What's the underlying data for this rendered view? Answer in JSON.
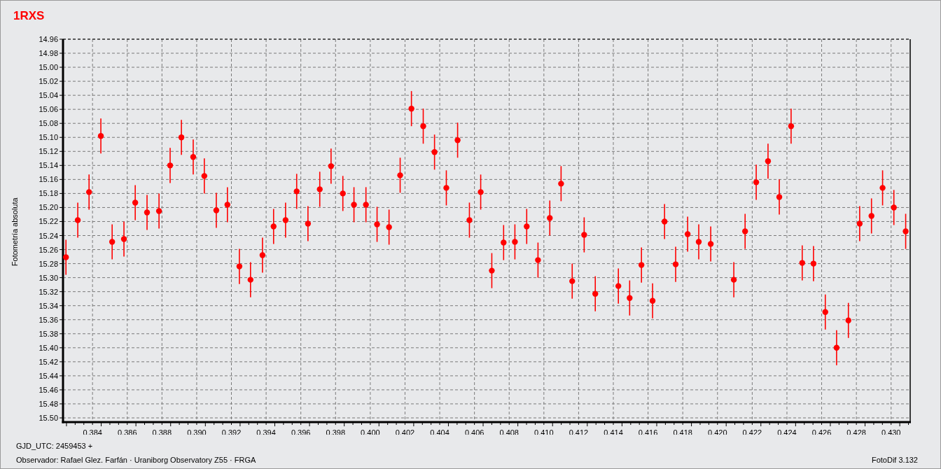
{
  "chart_data": {
    "type": "scatter",
    "title": "1RXS",
    "ylabel": "Fotometría absoluta",
    "xlim": [
      0.3823,
      0.4311
    ],
    "ylim": [
      15.506,
      14.96
    ],
    "xticks": [
      {
        "value": 0.384,
        "label": "0.384"
      },
      {
        "value": 0.386,
        "label": "0.386"
      },
      {
        "value": 0.388,
        "label": "0.388"
      },
      {
        "value": 0.39,
        "label": "0.390"
      },
      {
        "value": 0.392,
        "label": "0.392"
      },
      {
        "value": 0.394,
        "label": "0.394"
      },
      {
        "value": 0.396,
        "label": "0.396"
      },
      {
        "value": 0.398,
        "label": "0.398"
      },
      {
        "value": 0.4,
        "label": "0.400"
      },
      {
        "value": 0.402,
        "label": "0.402"
      },
      {
        "value": 0.404,
        "label": "0.404"
      },
      {
        "value": 0.406,
        "label": "0.406"
      },
      {
        "value": 0.408,
        "label": "0.408"
      },
      {
        "value": 0.41,
        "label": "0.410"
      },
      {
        "value": 0.412,
        "label": "0.412"
      },
      {
        "value": 0.414,
        "label": "0.414"
      },
      {
        "value": 0.416,
        "label": "0.416"
      },
      {
        "value": 0.418,
        "label": "0.418"
      },
      {
        "value": 0.42,
        "label": "0.420"
      },
      {
        "value": 0.422,
        "label": "0.422"
      },
      {
        "value": 0.424,
        "label": "0.424"
      },
      {
        "value": 0.426,
        "label": "0.426"
      },
      {
        "value": 0.428,
        "label": "0.428"
      },
      {
        "value": 0.43,
        "label": "0.430"
      }
    ],
    "yticks": [
      {
        "value": 14.96,
        "label": "14.96"
      },
      {
        "value": 14.98,
        "label": "14.98"
      },
      {
        "value": 15.0,
        "label": "15.00"
      },
      {
        "value": 15.02,
        "label": "15.02"
      },
      {
        "value": 15.04,
        "label": "15.04"
      },
      {
        "value": 15.06,
        "label": "15.06"
      },
      {
        "value": 15.08,
        "label": "15.08"
      },
      {
        "value": 15.1,
        "label": "15.10"
      },
      {
        "value": 15.12,
        "label": "15.12"
      },
      {
        "value": 15.14,
        "label": "15.14"
      },
      {
        "value": 15.16,
        "label": "15.16"
      },
      {
        "value": 15.18,
        "label": "15.18"
      },
      {
        "value": 15.2,
        "label": "15.20"
      },
      {
        "value": 15.22,
        "label": "15.22"
      },
      {
        "value": 15.24,
        "label": "15.24"
      },
      {
        "value": 15.26,
        "label": "15.26"
      },
      {
        "value": 15.28,
        "label": "15.28"
      },
      {
        "value": 15.3,
        "label": "15.30"
      },
      {
        "value": 15.32,
        "label": "15.32"
      },
      {
        "value": 15.34,
        "label": "15.34"
      },
      {
        "value": 15.36,
        "label": "15.36"
      },
      {
        "value": 15.38,
        "label": "15.38"
      },
      {
        "value": 15.4,
        "label": "15.40"
      },
      {
        "value": 15.42,
        "label": "15.42"
      },
      {
        "value": 15.44,
        "label": "15.44"
      },
      {
        "value": 15.46,
        "label": "15.46"
      },
      {
        "value": 15.48,
        "label": "15.48"
      },
      {
        "value": 15.5,
        "label": "15.50"
      }
    ],
    "x": [
      0.38247,
      0.38315,
      0.3838,
      0.38448,
      0.38513,
      0.38581,
      0.38646,
      0.38714,
      0.38783,
      0.38847,
      0.38912,
      0.3898,
      0.39044,
      0.39113,
      0.39177,
      0.39246,
      0.3931,
      0.39379,
      0.39443,
      0.39512,
      0.39576,
      0.39641,
      0.39709,
      0.39774,
      0.39842,
      0.39906,
      0.39975,
      0.40039,
      0.40108,
      0.40172,
      0.40237,
      0.40305,
      0.4037,
      0.40438,
      0.40503,
      0.40571,
      0.40636,
      0.407,
      0.40768,
      0.40833,
      0.40901,
      0.40966,
      0.41034,
      0.41099,
      0.41163,
      0.41232,
      0.41296,
      0.41429,
      0.41494,
      0.41562,
      0.41626,
      0.41695,
      0.41759,
      0.41828,
      0.41892,
      0.41961,
      0.42094,
      0.42159,
      0.42223,
      0.42291,
      0.42356,
      0.42424,
      0.42488,
      0.42553,
      0.42621,
      0.42686,
      0.42754,
      0.42819,
      0.42887,
      0.42951,
      0.43016,
      0.43084
    ],
    "grid": true,
    "series": [
      {
        "color": "#ff0000",
        "errors": [
          0.025,
          0.025,
          0.025,
          0.025,
          0.025,
          0.025,
          0.025,
          0.025,
          0.025,
          0.025,
          0.025,
          0.025,
          0.025,
          0.025,
          0.025,
          0.025,
          0.025,
          0.025,
          0.025,
          0.025,
          0.025,
          0.025,
          0.025,
          0.025,
          0.025,
          0.025,
          0.025,
          0.025,
          0.025,
          0.025,
          0.025,
          0.025,
          0.025,
          0.025,
          0.025,
          0.025,
          0.025,
          0.025,
          0.025,
          0.025,
          0.025,
          0.025,
          0.025,
          0.025,
          0.025,
          0.025,
          0.025,
          0.025,
          0.025,
          0.025,
          0.025,
          0.025,
          0.025,
          0.025,
          0.025,
          0.025,
          0.025,
          0.025,
          0.025,
          0.025,
          0.025,
          0.025,
          0.025,
          0.025,
          0.025,
          0.025,
          0.025,
          0.025,
          0.025,
          0.025,
          0.025,
          0.025
        ],
        "values": [
          15.271,
          15.218,
          15.178,
          15.098,
          15.249,
          15.245,
          15.193,
          15.207,
          15.205,
          15.14,
          15.1,
          15.128,
          15.155,
          15.204,
          15.196,
          15.284,
          15.303,
          15.268,
          15.227,
          15.218,
          15.177,
          15.223,
          15.174,
          15.141,
          15.18,
          15.196,
          15.196,
          15.224,
          15.228,
          15.154,
          15.059,
          15.084,
          15.121,
          15.172,
          15.104,
          15.218,
          15.178,
          15.29,
          15.25,
          15.249,
          15.227,
          15.275,
          15.215,
          15.166,
          15.305,
          15.239,
          15.323,
          15.312,
          15.329,
          15.282,
          15.333,
          15.22,
          15.281,
          15.238,
          15.249,
          15.252,
          15.303,
          15.234,
          15.164,
          15.134,
          15.185,
          15.084,
          15.279,
          15.28,
          15.349,
          15.4,
          15.361,
          15.223,
          15.212,
          15.172,
          15.2,
          15.234
        ]
      }
    ]
  },
  "footer": {
    "date_base": "GJD_UTC: 2459453 +",
    "observer": "Observador: Rafael Glez. Farfán · Uraniborg Observatory Z55 · FRGA",
    "version": "FotoDif 3.132"
  }
}
